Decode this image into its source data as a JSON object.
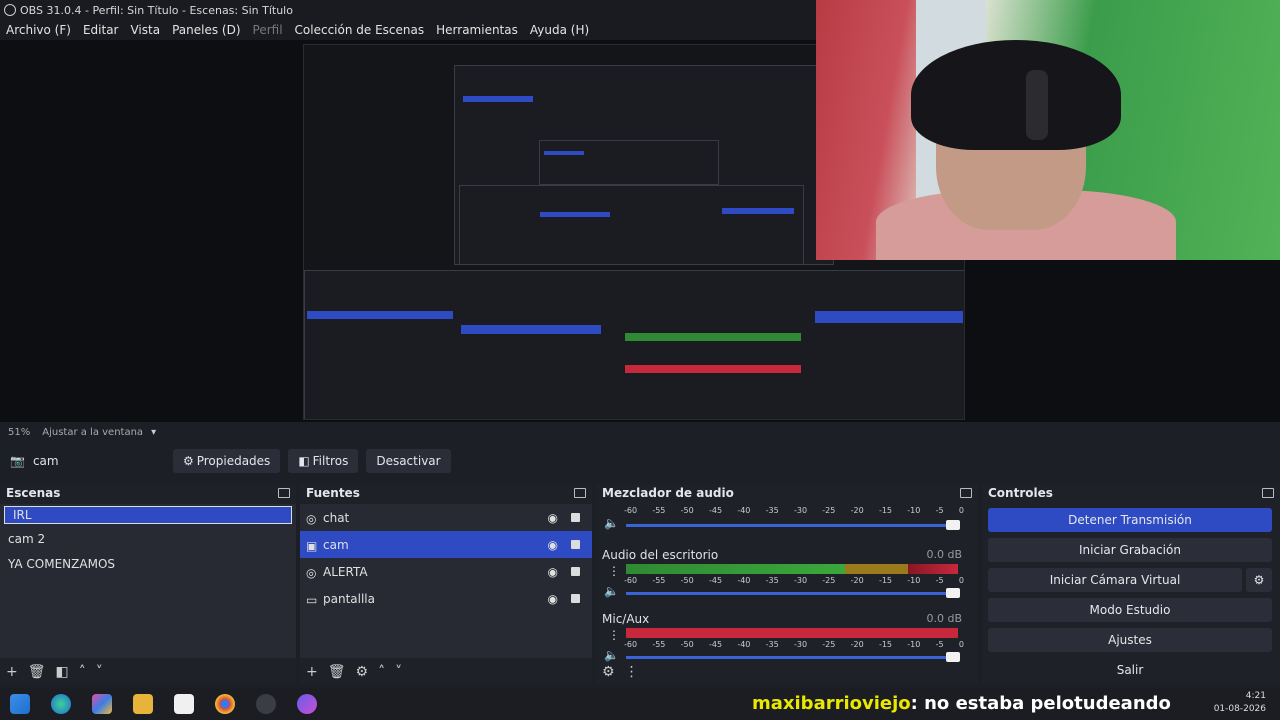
{
  "window_title": "OBS 31.0.4 - Perfil: Sin Título - Escenas: Sin Título",
  "menu": [
    {
      "label": "Archivo (F)",
      "enabled": true
    },
    {
      "label": "Editar",
      "enabled": true
    },
    {
      "label": "Vista",
      "enabled": true
    },
    {
      "label": "Paneles (D)",
      "enabled": true
    },
    {
      "label": "Perfil",
      "enabled": false
    },
    {
      "label": "Colección de Escenas",
      "enabled": true
    },
    {
      "label": "Herramientas",
      "enabled": true
    },
    {
      "label": "Ayuda (H)",
      "enabled": true
    }
  ],
  "zoom": {
    "percent": "51%",
    "fit_label": "Ajustar a la ventana"
  },
  "source_toolbar": {
    "selected_source": "cam",
    "properties_label": "Propiedades",
    "filters_label": "Filtros",
    "deactivate_label": "Desactivar"
  },
  "scenes": {
    "title": "Escenas",
    "items": [
      {
        "label": "IRL",
        "selected": true
      },
      {
        "label": "cam 2",
        "selected": false
      },
      {
        "label": "YA COMENZAMOS",
        "selected": false
      }
    ]
  },
  "sources": {
    "title": "Fuentes",
    "items": [
      {
        "label": "chat",
        "icon": "browser-icon",
        "selected": false
      },
      {
        "label": "cam",
        "icon": "camera-icon",
        "selected": true
      },
      {
        "label": "ALERTA",
        "icon": "browser-icon",
        "selected": false
      },
      {
        "label": "pantallla",
        "icon": "monitor-icon",
        "selected": false
      }
    ]
  },
  "mixer": {
    "title": "Mezclador de audio",
    "tick_labels": [
      "-60",
      "-55",
      "-50",
      "-45",
      "-40",
      "-35",
      "-30",
      "-25",
      "-20",
      "-15",
      "-10",
      "-5",
      "0"
    ],
    "channels": [
      {
        "name": "Audio del escritorio",
        "db": "0.0 dB"
      },
      {
        "name": "Mic/Aux",
        "db": "0.0 dB"
      }
    ]
  },
  "controls": {
    "title": "Controles",
    "buttons": [
      {
        "label": "Detener Transmisión",
        "primary": true
      },
      {
        "label": "Iniciar Grabación",
        "primary": false
      },
      {
        "label": "Iniciar Cámara Virtual",
        "primary": false
      },
      {
        "label": "Modo Estudio",
        "primary": false
      },
      {
        "label": "Ajustes",
        "primary": false
      },
      {
        "label": "Salir",
        "primary": false
      }
    ]
  },
  "chat_overlay": {
    "user": "maxibarrioviejo",
    "message": " : no estaba pelotudeando"
  },
  "clock": {
    "time": "4:21",
    "date": "01-08-2026"
  },
  "colors": {
    "accent": "#2e4bc4",
    "chat_user": "#e8e800",
    "meter_green": "#3aa83a",
    "meter_red": "#c8283c"
  }
}
